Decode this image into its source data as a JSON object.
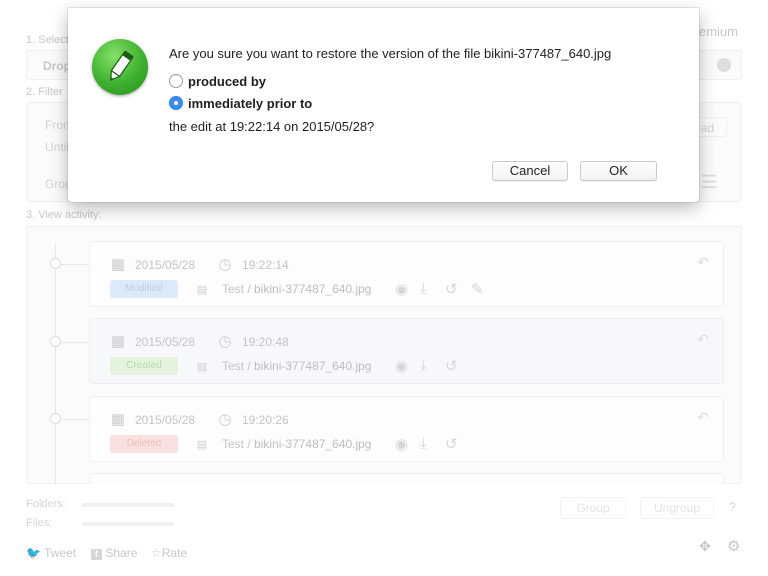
{
  "background": {
    "header": {
      "premium_label": "Premium"
    },
    "section1": {
      "label": "1. Select",
      "dropdown_value": "Drop"
    },
    "section2": {
      "label": "2. Filter",
      "from_label": "From",
      "until_label": "Until",
      "group_label": "Grou",
      "load_label": "ad"
    },
    "section3": {
      "label": "3. View activity:"
    },
    "activities": [
      {
        "date": "2015/05/28",
        "time": "19:22:14",
        "badge": "Modified",
        "badge_color": "#dbe9f8",
        "badge_text_color": "#b9cfe8",
        "folder": "Test",
        "file": "bikini-377487_640.jpg"
      },
      {
        "date": "2015/05/28",
        "time": "19:20:48",
        "badge": "Created",
        "badge_color": "#e3f3dc",
        "badge_text_color": "#bcd9b0",
        "folder": "Test",
        "file": "bikini-377487_640.jpg"
      },
      {
        "date": "2015/05/28",
        "time": "19:20:26",
        "badge": "Deleted",
        "badge_color": "#f8e1de",
        "badge_text_color": "#ebbcb6",
        "folder": "Test",
        "file": "bikini-377487_640.jpg"
      }
    ],
    "footer": {
      "folders_label": "Folders:",
      "files_label": "Files:",
      "ungroup_label": "Ungroup",
      "group_label": "Group",
      "help_label": "?",
      "tweet_label": "Tweet",
      "share_label": "Share",
      "rate_label": "Rate"
    }
  },
  "dialog": {
    "message": "Are you sure you want to restore the version of the file bikini-377487_640.jpg",
    "options": [
      {
        "label": "produced by",
        "selected": false
      },
      {
        "label": "immediately prior to",
        "selected": true
      }
    ],
    "detail": "the edit at 19:22:14 on 2015/05/28?",
    "cancel_label": "Cancel",
    "ok_label": "OK",
    "icon": "green-pencil-app-icon"
  }
}
